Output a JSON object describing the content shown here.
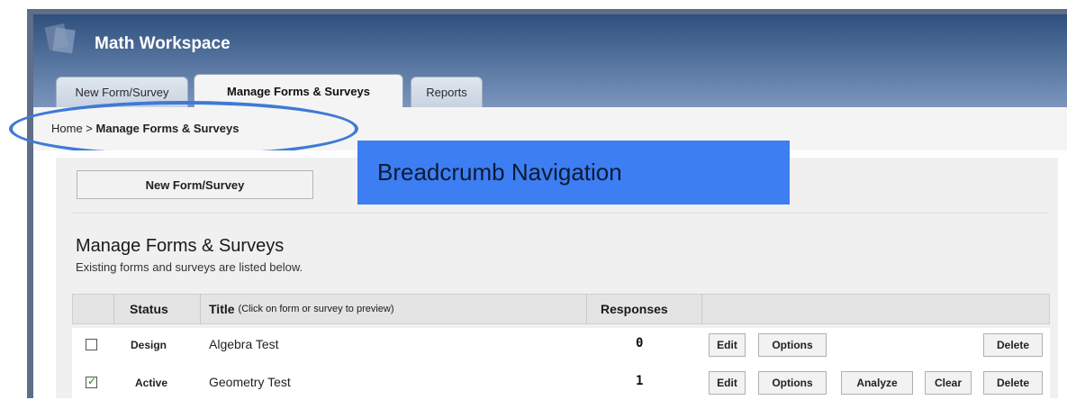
{
  "app": {
    "title_bold": "Math",
    "title_rest": " Workspace"
  },
  "tabs": [
    {
      "label": "New Form/Survey",
      "active": false
    },
    {
      "label": "Manage Forms & Surveys",
      "active": true
    },
    {
      "label": "Reports",
      "active": false
    }
  ],
  "breadcrumb": {
    "home": "Home",
    "separator": " > ",
    "current": "Manage Forms & Surveys"
  },
  "annotation": {
    "label": "Breadcrumb Navigation",
    "color": "#3d7ef2",
    "ellipse_color": "#3f7ad6"
  },
  "main": {
    "new_button_label": "New Form/Survey",
    "title": "Manage Forms & Surveys",
    "subtitle": "Existing forms and surveys are listed below."
  },
  "table": {
    "headers": {
      "status": "Status",
      "title": "Title",
      "title_note": "(Click on form or survey to preview)",
      "responses": "Responses"
    },
    "rows": [
      {
        "checked": false,
        "status": "Design",
        "title": "Algebra Test",
        "responses": "0",
        "actions": [
          "Edit",
          "Options",
          "Delete"
        ]
      },
      {
        "checked": true,
        "status": "Active",
        "title": "Geometry Test",
        "responses": "1",
        "actions": [
          "Edit",
          "Options",
          "Analyze",
          "Clear",
          "Delete"
        ]
      }
    ]
  },
  "colors": {
    "header": "#2f4f7d",
    "panel": "#f0f0f0",
    "table_header": "#e4e4e4"
  }
}
